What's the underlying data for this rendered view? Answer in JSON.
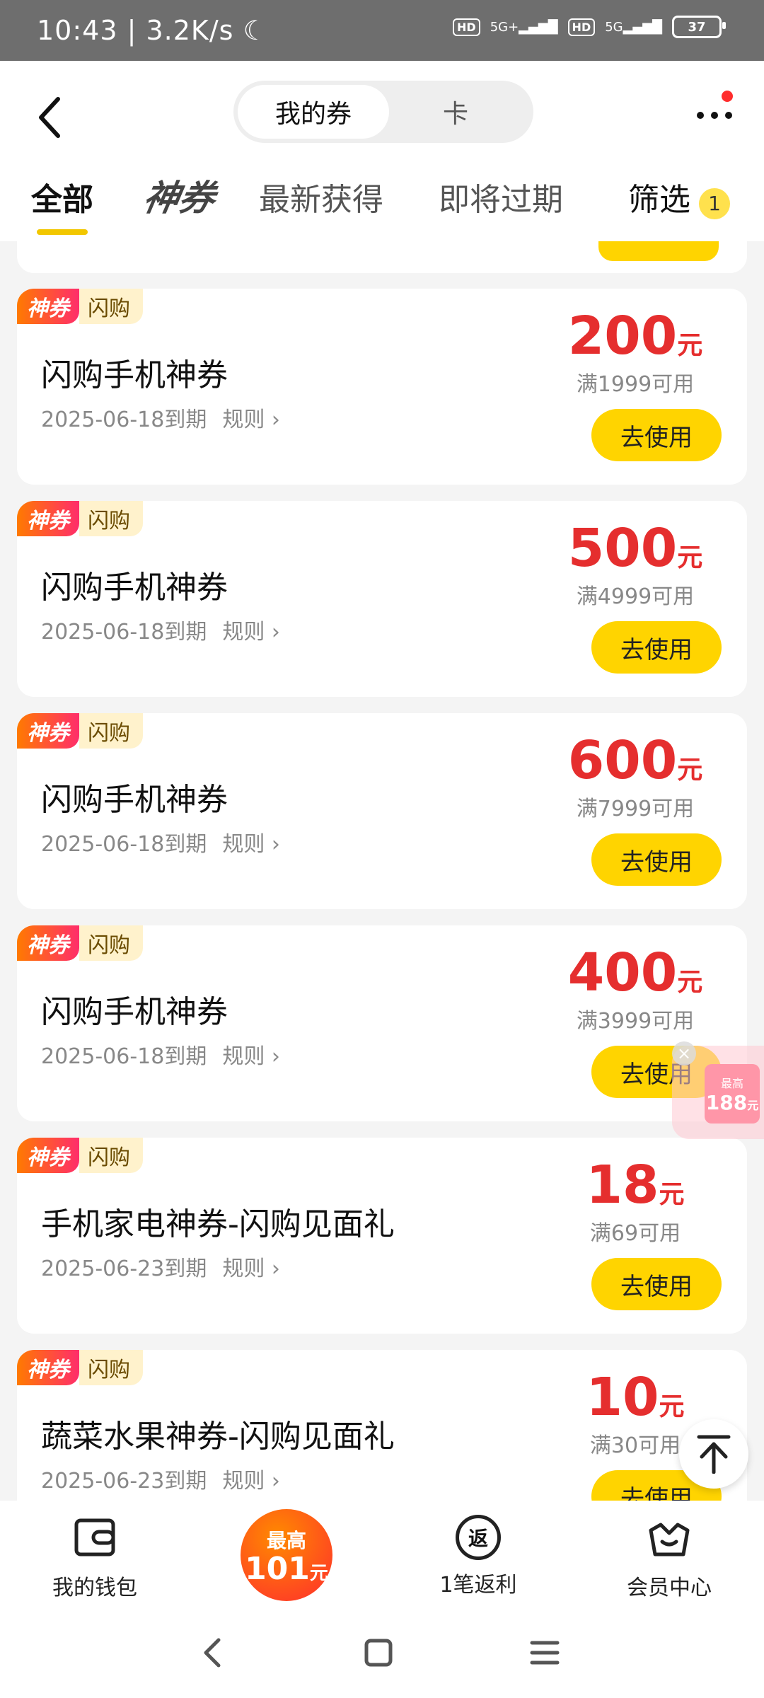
{
  "status_bar": {
    "time": "10:43",
    "speed": "3.2K/s",
    "hd1": "HD",
    "net1": "5G+",
    "hd2": "HD",
    "net2": "5G",
    "battery": "37"
  },
  "header": {
    "segment": {
      "active": "我的券",
      "inactive": "卡"
    }
  },
  "tabs": [
    {
      "label": "全部"
    },
    {
      "label": "神券"
    },
    {
      "label": "最新获得"
    },
    {
      "label": "即将过期"
    },
    {
      "label": "筛选",
      "badge": "1"
    }
  ],
  "coupons": [
    {
      "tag1": "神券",
      "tag2": "闪购",
      "title": "闪购手机神券",
      "expire": "2025-06-18到期",
      "rule": "规则",
      "amount": "200",
      "unit": "元",
      "condition": "满1999可用",
      "button": "去使用"
    },
    {
      "tag1": "神券",
      "tag2": "闪购",
      "title": "闪购手机神券",
      "expire": "2025-06-18到期",
      "rule": "规则",
      "amount": "500",
      "unit": "元",
      "condition": "满4999可用",
      "button": "去使用"
    },
    {
      "tag1": "神券",
      "tag2": "闪购",
      "title": "闪购手机神券",
      "expire": "2025-06-18到期",
      "rule": "规则",
      "amount": "600",
      "unit": "元",
      "condition": "满7999可用",
      "button": "去使用"
    },
    {
      "tag1": "神券",
      "tag2": "闪购",
      "title": "闪购手机神券",
      "expire": "2025-06-18到期",
      "rule": "规则",
      "amount": "400",
      "unit": "元",
      "condition": "满3999可用",
      "button": "去使用"
    },
    {
      "tag1": "神券",
      "tag2": "闪购",
      "title": "手机家电神券-闪购见面礼",
      "expire": "2025-06-23到期",
      "rule": "规则",
      "amount": "18",
      "unit": "元",
      "condition": "满69可用",
      "button": "去使用"
    },
    {
      "tag1": "神券",
      "tag2": "闪购",
      "title": "蔬菜水果神券-闪购见面礼",
      "expire": "2025-06-23到期",
      "rule": "规则",
      "amount": "10",
      "unit": "元",
      "condition": "满30可用",
      "button": "去使用"
    }
  ],
  "floating_ad": {
    "small": "最高",
    "value": "188",
    "unit": "元"
  },
  "bottom_nav": {
    "wallet": "我的钱包",
    "promo_top": "最高",
    "promo_value": "101",
    "promo_unit": "元",
    "rebate": "1笔返利",
    "rebate_icon_char": "返",
    "member": "会员中心"
  }
}
